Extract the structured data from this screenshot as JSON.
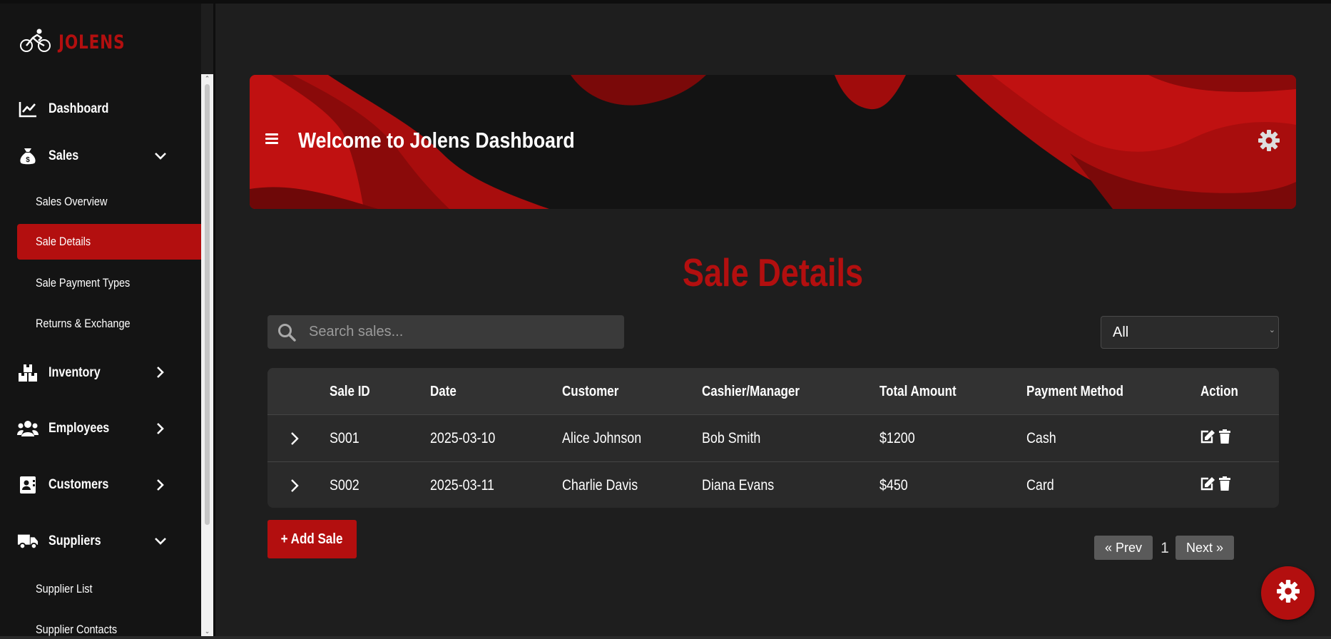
{
  "brand": {
    "name": "JOLENS",
    "logo_icon": "cyclist-icon"
  },
  "sidebar": {
    "items": [
      {
        "label": "Dashboard",
        "icon": "chart-line-icon"
      },
      {
        "label": "Sales",
        "icon": "money-bag-icon",
        "expanded": true
      },
      {
        "label": "Sales Overview"
      },
      {
        "label": "Sale Details",
        "active": true
      },
      {
        "label": "Sale Payment Types"
      },
      {
        "label": "Returns & Exchange"
      },
      {
        "label": "Inventory",
        "icon": "boxes-icon",
        "expanded": false
      },
      {
        "label": "Employees",
        "icon": "users-icon",
        "expanded": false
      },
      {
        "label": "Customers",
        "icon": "address-card-icon",
        "expanded": false
      },
      {
        "label": "Suppliers",
        "icon": "truck-icon",
        "expanded": true
      },
      {
        "label": "Supplier List"
      },
      {
        "label": "Supplier Contacts"
      }
    ]
  },
  "header": {
    "title": "Welcome to Jolens Dashboard"
  },
  "main": {
    "title": "Sale Details",
    "search": {
      "placeholder": "Search sales...",
      "value": ""
    },
    "filter": {
      "selected": "All"
    },
    "table": {
      "columns": [
        "",
        "Sale ID",
        "Date",
        "Customer",
        "Cashier/Manager",
        "Total Amount",
        "Payment Method",
        "Action"
      ],
      "rows": [
        [
          "S001",
          "2025-03-10",
          "Alice Johnson",
          "Bob Smith",
          "$1200",
          "Cash"
        ],
        [
          "S002",
          "2025-03-11",
          "Charlie Davis",
          "Diana Evans",
          "$450",
          "Card"
        ]
      ]
    },
    "add_button": "+ Add Sale",
    "pagination": {
      "prev": "« Prev",
      "page": "1",
      "next": "Next »"
    }
  },
  "colors": {
    "accent": "#b30f0f",
    "background": "#1e1e1e",
    "sidebar": "#141414"
  }
}
